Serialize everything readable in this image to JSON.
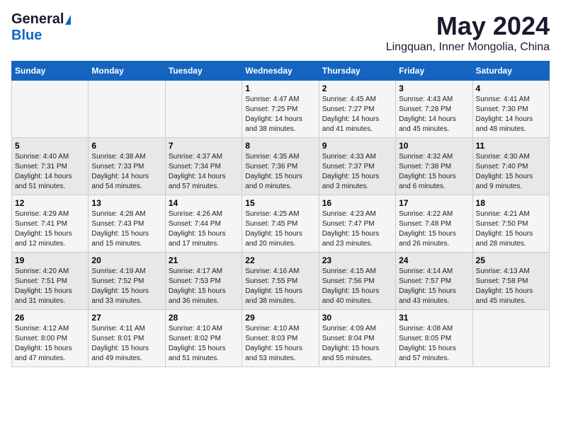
{
  "header": {
    "logo_general": "General",
    "logo_blue": "Blue",
    "title": "May 2024",
    "subtitle": "Lingquan, Inner Mongolia, China"
  },
  "calendar": {
    "days_of_week": [
      "Sunday",
      "Monday",
      "Tuesday",
      "Wednesday",
      "Thursday",
      "Friday",
      "Saturday"
    ],
    "weeks": [
      [
        {
          "day": "",
          "info": ""
        },
        {
          "day": "",
          "info": ""
        },
        {
          "day": "",
          "info": ""
        },
        {
          "day": "1",
          "info": "Sunrise: 4:47 AM\nSunset: 7:25 PM\nDaylight: 14 hours\nand 38 minutes."
        },
        {
          "day": "2",
          "info": "Sunrise: 4:45 AM\nSunset: 7:27 PM\nDaylight: 14 hours\nand 41 minutes."
        },
        {
          "day": "3",
          "info": "Sunrise: 4:43 AM\nSunset: 7:28 PM\nDaylight: 14 hours\nand 45 minutes."
        },
        {
          "day": "4",
          "info": "Sunrise: 4:41 AM\nSunset: 7:30 PM\nDaylight: 14 hours\nand 48 minutes."
        }
      ],
      [
        {
          "day": "5",
          "info": "Sunrise: 4:40 AM\nSunset: 7:31 PM\nDaylight: 14 hours\nand 51 minutes."
        },
        {
          "day": "6",
          "info": "Sunrise: 4:38 AM\nSunset: 7:33 PM\nDaylight: 14 hours\nand 54 minutes."
        },
        {
          "day": "7",
          "info": "Sunrise: 4:37 AM\nSunset: 7:34 PM\nDaylight: 14 hours\nand 57 minutes."
        },
        {
          "day": "8",
          "info": "Sunrise: 4:35 AM\nSunset: 7:36 PM\nDaylight: 15 hours\nand 0 minutes."
        },
        {
          "day": "9",
          "info": "Sunrise: 4:33 AM\nSunset: 7:37 PM\nDaylight: 15 hours\nand 3 minutes."
        },
        {
          "day": "10",
          "info": "Sunrise: 4:32 AM\nSunset: 7:38 PM\nDaylight: 15 hours\nand 6 minutes."
        },
        {
          "day": "11",
          "info": "Sunrise: 4:30 AM\nSunset: 7:40 PM\nDaylight: 15 hours\nand 9 minutes."
        }
      ],
      [
        {
          "day": "12",
          "info": "Sunrise: 4:29 AM\nSunset: 7:41 PM\nDaylight: 15 hours\nand 12 minutes."
        },
        {
          "day": "13",
          "info": "Sunrise: 4:28 AM\nSunset: 7:43 PM\nDaylight: 15 hours\nand 15 minutes."
        },
        {
          "day": "14",
          "info": "Sunrise: 4:26 AM\nSunset: 7:44 PM\nDaylight: 15 hours\nand 17 minutes."
        },
        {
          "day": "15",
          "info": "Sunrise: 4:25 AM\nSunset: 7:45 PM\nDaylight: 15 hours\nand 20 minutes."
        },
        {
          "day": "16",
          "info": "Sunrise: 4:23 AM\nSunset: 7:47 PM\nDaylight: 15 hours\nand 23 minutes."
        },
        {
          "day": "17",
          "info": "Sunrise: 4:22 AM\nSunset: 7:48 PM\nDaylight: 15 hours\nand 26 minutes."
        },
        {
          "day": "18",
          "info": "Sunrise: 4:21 AM\nSunset: 7:50 PM\nDaylight: 15 hours\nand 28 minutes."
        }
      ],
      [
        {
          "day": "19",
          "info": "Sunrise: 4:20 AM\nSunset: 7:51 PM\nDaylight: 15 hours\nand 31 minutes."
        },
        {
          "day": "20",
          "info": "Sunrise: 4:19 AM\nSunset: 7:52 PM\nDaylight: 15 hours\nand 33 minutes."
        },
        {
          "day": "21",
          "info": "Sunrise: 4:17 AM\nSunset: 7:53 PM\nDaylight: 15 hours\nand 36 minutes."
        },
        {
          "day": "22",
          "info": "Sunrise: 4:16 AM\nSunset: 7:55 PM\nDaylight: 15 hours\nand 38 minutes."
        },
        {
          "day": "23",
          "info": "Sunrise: 4:15 AM\nSunset: 7:56 PM\nDaylight: 15 hours\nand 40 minutes."
        },
        {
          "day": "24",
          "info": "Sunrise: 4:14 AM\nSunset: 7:57 PM\nDaylight: 15 hours\nand 43 minutes."
        },
        {
          "day": "25",
          "info": "Sunrise: 4:13 AM\nSunset: 7:58 PM\nDaylight: 15 hours\nand 45 minutes."
        }
      ],
      [
        {
          "day": "26",
          "info": "Sunrise: 4:12 AM\nSunset: 8:00 PM\nDaylight: 15 hours\nand 47 minutes."
        },
        {
          "day": "27",
          "info": "Sunrise: 4:11 AM\nSunset: 8:01 PM\nDaylight: 15 hours\nand 49 minutes."
        },
        {
          "day": "28",
          "info": "Sunrise: 4:10 AM\nSunset: 8:02 PM\nDaylight: 15 hours\nand 51 minutes."
        },
        {
          "day": "29",
          "info": "Sunrise: 4:10 AM\nSunset: 8:03 PM\nDaylight: 15 hours\nand 53 minutes."
        },
        {
          "day": "30",
          "info": "Sunrise: 4:09 AM\nSunset: 8:04 PM\nDaylight: 15 hours\nand 55 minutes."
        },
        {
          "day": "31",
          "info": "Sunrise: 4:08 AM\nSunset: 8:05 PM\nDaylight: 15 hours\nand 57 minutes."
        },
        {
          "day": "",
          "info": ""
        }
      ]
    ]
  }
}
